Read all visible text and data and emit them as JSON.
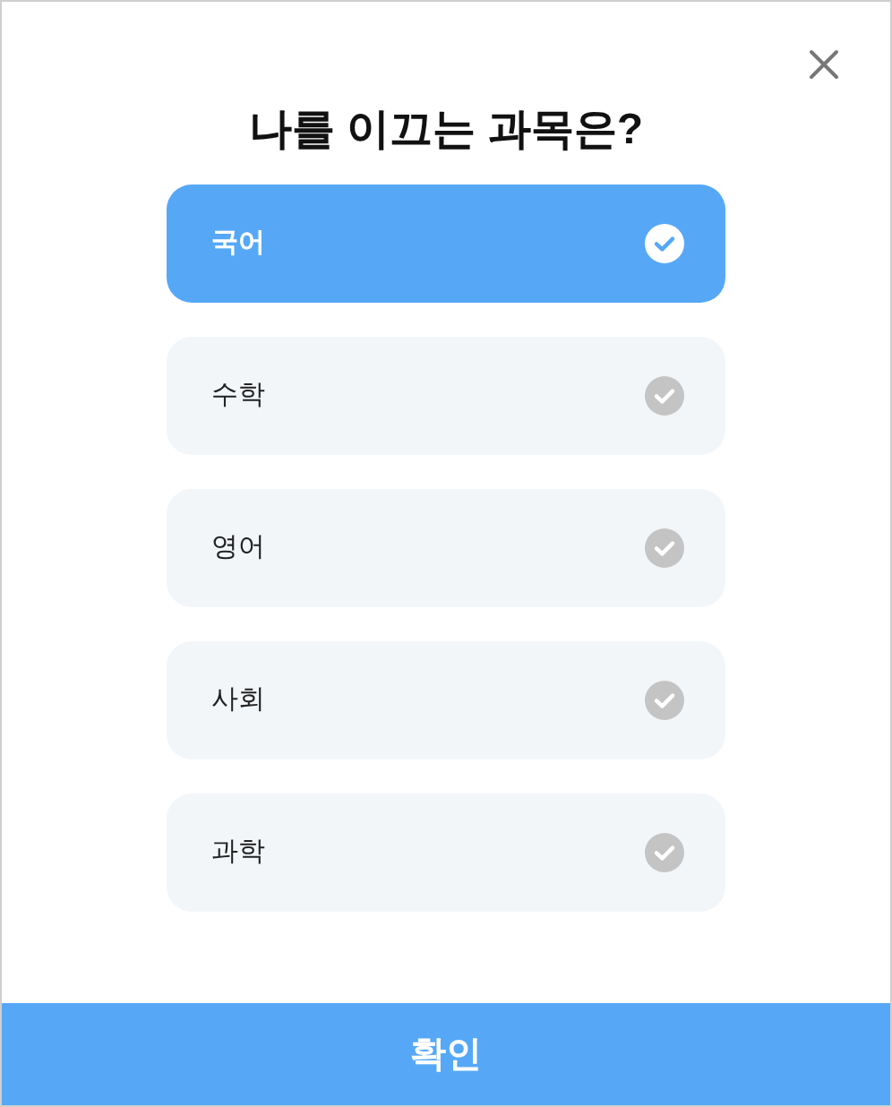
{
  "title": "나를 이끄는 과목은?",
  "options": [
    {
      "label": "국어",
      "selected": true
    },
    {
      "label": "수학",
      "selected": false
    },
    {
      "label": "영어",
      "selected": false
    },
    {
      "label": "사회",
      "selected": false
    },
    {
      "label": "과학",
      "selected": false
    }
  ],
  "confirm_button": "확인"
}
